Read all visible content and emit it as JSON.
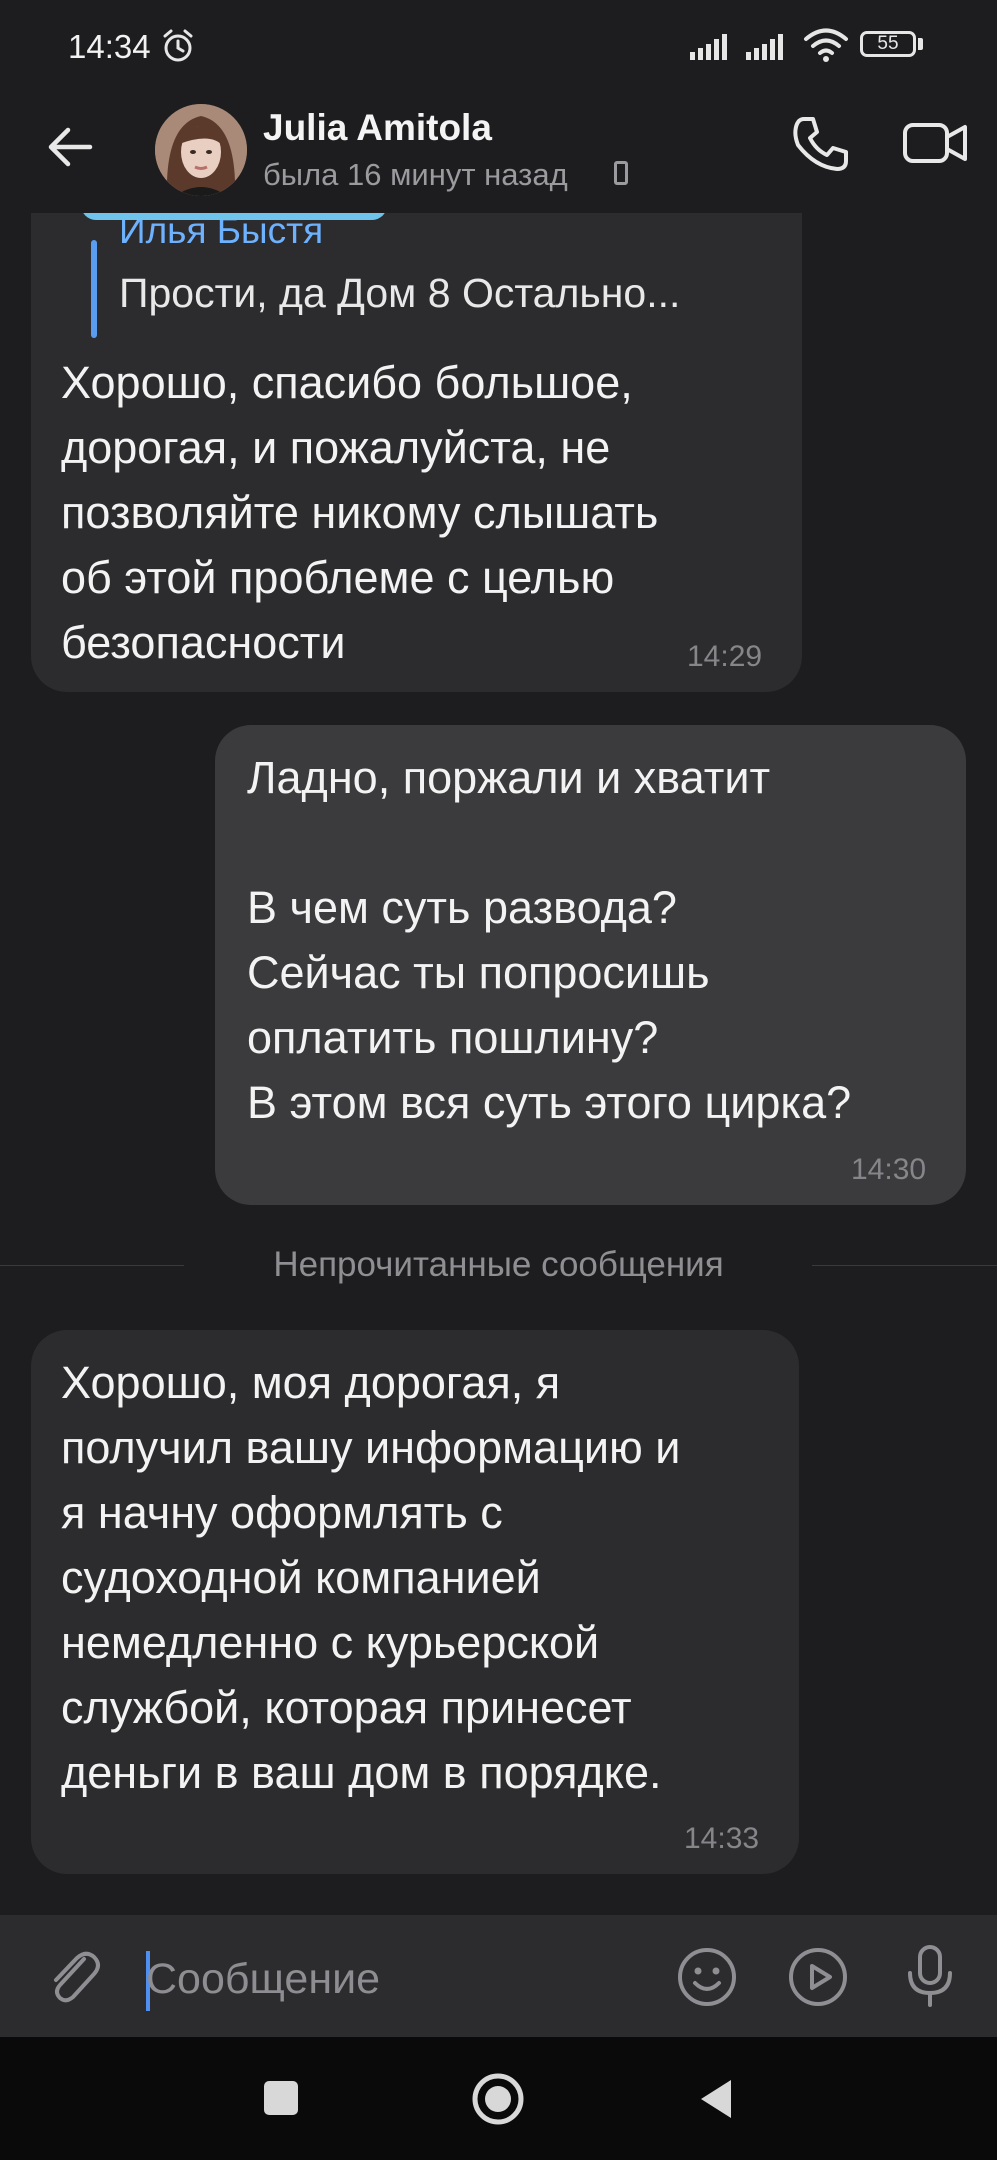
{
  "status_bar": {
    "time": "14:34",
    "battery": "55",
    "icons": [
      "alarm-icon",
      "signal-icon",
      "signal-icon",
      "wifi-icon",
      "battery-icon"
    ]
  },
  "header": {
    "contact_name": "Julia Amitola",
    "last_seen": "была 16 минут назад",
    "icons": [
      "back-arrow-icon",
      "phone-icon",
      "video-camera-icon"
    ]
  },
  "messages": [
    {
      "direction": "incoming",
      "reply": {
        "author": "Илья Быстя",
        "text": "Прости, да  Дом 8  Остально..."
      },
      "text": "Хорошо, спасибо большое,\nдорогая, и пожалуйста, не\nпозволяйте никому слышать\nоб этой проблеме с целью\nбезопасности",
      "time": "14:29"
    },
    {
      "direction": "outgoing",
      "text": "Ладно, поржали и хватит\n\nВ чем суть развода?\nСейчас ты попросишь\nоплатить пошлину?\nВ этом вся суть этого цирка?",
      "time": "14:30"
    },
    {
      "direction": "incoming",
      "text": "Хорошо, моя дорогая, я\nполучил вашу информацию и\nя начну оформлять с\nсудоходной компанией\nнемедленно с курьерской\nслужбой, которая принесет\nденьги в ваш дом в порядке.",
      "time": "14:33"
    }
  ],
  "divider": {
    "label": "Непрочитанные сообщения"
  },
  "input_bar": {
    "placeholder": "Сообщение",
    "value": "",
    "icons": [
      "attach-icon",
      "emoji-icon",
      "sticker-icon",
      "microphone-icon"
    ]
  },
  "colors": {
    "background": "#1d1d1f",
    "incoming_bubble": "#2c2c2e",
    "outgoing_bubble": "#3b3b3d",
    "accent": "#5a9cf0"
  }
}
